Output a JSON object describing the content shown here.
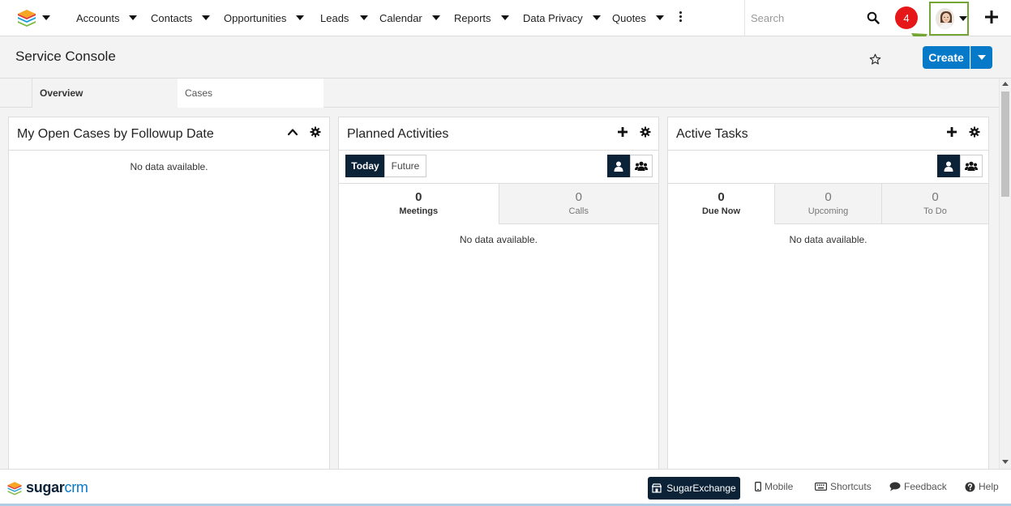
{
  "nav": {
    "items": [
      {
        "label": "Accounts"
      },
      {
        "label": "Contacts"
      },
      {
        "label": "Opportunities"
      },
      {
        "label": "Leads"
      },
      {
        "label": "Calendar"
      },
      {
        "label": "Reports"
      },
      {
        "label": "Data Privacy"
      },
      {
        "label": "Quotes"
      }
    ],
    "search_placeholder": "Search",
    "notification_count": "4"
  },
  "header": {
    "title": "Service Console",
    "create_label": "Create"
  },
  "tabs": [
    {
      "label": "Overview",
      "active": true
    },
    {
      "label": "Cases",
      "active": false
    }
  ],
  "dashlets": {
    "open_cases": {
      "title": "My Open Cases by Followup Date",
      "empty_text": "No data available."
    },
    "planned_activities": {
      "title": "Planned Activities",
      "filters": [
        "Today",
        "Future"
      ],
      "subtabs": [
        {
          "count": "0",
          "label": "Meetings"
        },
        {
          "count": "0",
          "label": "Calls"
        }
      ],
      "empty_text": "No data available."
    },
    "active_tasks": {
      "title": "Active Tasks",
      "subtabs": [
        {
          "count": "0",
          "label": "Due Now"
        },
        {
          "count": "0",
          "label": "Upcoming"
        },
        {
          "count": "0",
          "label": "To Do"
        }
      ],
      "empty_text": "No data available."
    }
  },
  "footer": {
    "logo_bold": "sugar",
    "logo_light": "crm",
    "exchange_label": "SugarExchange",
    "mobile_label": "Mobile",
    "shortcuts_label": "Shortcuts",
    "feedback_label": "Feedback",
    "help_label": "Help"
  },
  "colors": {
    "accent": "#0679c8",
    "dark": "#0b2237",
    "notification": "#e61718",
    "highlight": "#73a532"
  },
  "icons": [
    "sugar-logo-icon",
    "search-icon",
    "avatar",
    "plus-icon",
    "star-icon",
    "caret-down-icon",
    "chevron-up-icon",
    "gear-icon",
    "user-icon",
    "group-icon",
    "store-icon",
    "mobile-icon",
    "keyboard-icon",
    "comment-icon",
    "help-icon"
  ]
}
